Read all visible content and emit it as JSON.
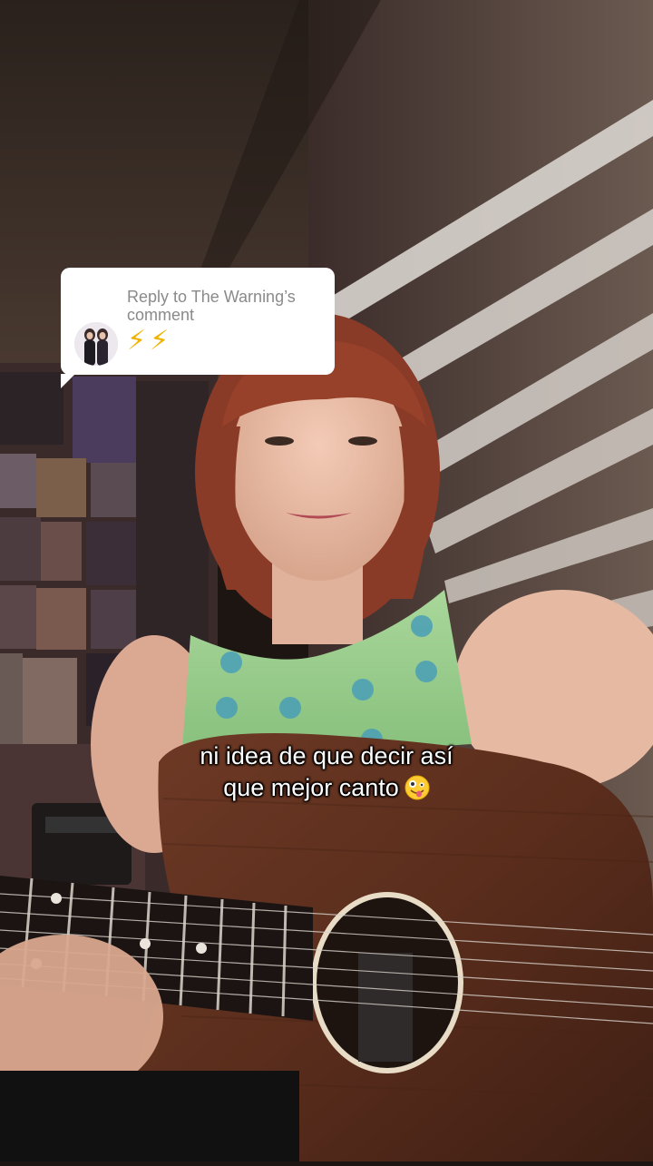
{
  "reply": {
    "title": "Reply to The Warning’s comment",
    "text": "⚡⚡"
  },
  "caption": {
    "line1": "ni idea de que decir así",
    "line2": "que mejor canto"
  },
  "icons": {
    "caption_emoji": "zany-face-emoji",
    "avatar": "commenter-avatar"
  },
  "colors": {
    "reply_card": "#ffffff",
    "reply_title": "#8a8a8a",
    "caption_text": "#ffffff",
    "lightning": "#f0b400"
  }
}
